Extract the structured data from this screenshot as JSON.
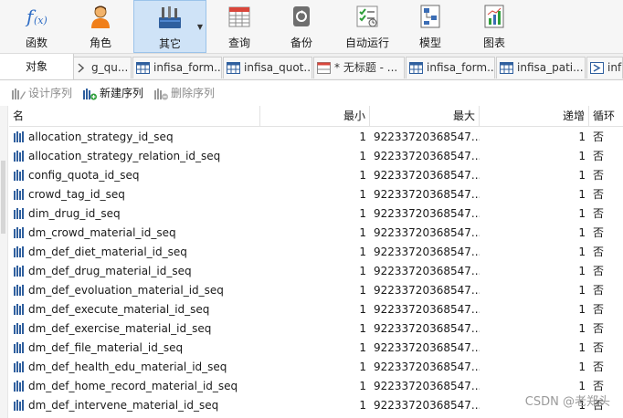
{
  "toolbar": {
    "buttons": [
      {
        "label": "函数",
        "icon": "function-icon"
      },
      {
        "label": "角色",
        "icon": "user-icon"
      },
      {
        "label": "其它",
        "icon": "tools-icon",
        "active": true
      },
      {
        "label": "查询",
        "icon": "query-table-icon"
      },
      {
        "label": "备份",
        "icon": "backup-icon"
      },
      {
        "label": "自动运行",
        "icon": "checklist-icon"
      },
      {
        "label": "模型",
        "icon": "model-icon"
      },
      {
        "label": "图表",
        "icon": "chart-icon"
      }
    ],
    "caret": "▼"
  },
  "tabs": {
    "objects_label": "对象",
    "items": [
      {
        "label": "g_qu..."
      },
      {
        "label": "infisa_form..."
      },
      {
        "label": "infisa_quot..."
      },
      {
        "label": "* 无标题 - ..."
      },
      {
        "label": "infisa_form..."
      },
      {
        "label": "infisa_pati..."
      },
      {
        "label": "inf"
      }
    ]
  },
  "actions": {
    "design": "设计序列",
    "create": "新建序列",
    "delete": "删除序列"
  },
  "grid": {
    "columns": [
      "名",
      "最小",
      "最大",
      "递增",
      "循环"
    ],
    "rows": [
      {
        "name": "allocation_strategy_id_seq",
        "min": "1",
        "max": "92233720368547...",
        "inc": "1",
        "cycle": "否"
      },
      {
        "name": "allocation_strategy_relation_id_seq",
        "min": "1",
        "max": "92233720368547...",
        "inc": "1",
        "cycle": "否"
      },
      {
        "name": "config_quota_id_seq",
        "min": "1",
        "max": "92233720368547...",
        "inc": "1",
        "cycle": "否"
      },
      {
        "name": "crowd_tag_id_seq",
        "min": "1",
        "max": "92233720368547...",
        "inc": "1",
        "cycle": "否"
      },
      {
        "name": "dim_drug_id_seq",
        "min": "1",
        "max": "92233720368547...",
        "inc": "1",
        "cycle": "否"
      },
      {
        "name": "dm_crowd_material_id_seq",
        "min": "1",
        "max": "92233720368547...",
        "inc": "1",
        "cycle": "否"
      },
      {
        "name": "dm_def_diet_material_id_seq",
        "min": "1",
        "max": "92233720368547...",
        "inc": "1",
        "cycle": "否"
      },
      {
        "name": "dm_def_drug_material_id_seq",
        "min": "1",
        "max": "92233720368547...",
        "inc": "1",
        "cycle": "否"
      },
      {
        "name": "dm_def_evoluation_material_id_seq",
        "min": "1",
        "max": "92233720368547...",
        "inc": "1",
        "cycle": "否"
      },
      {
        "name": "dm_def_execute_material_id_seq",
        "min": "1",
        "max": "92233720368547...",
        "inc": "1",
        "cycle": "否"
      },
      {
        "name": "dm_def_exercise_material_id_seq",
        "min": "1",
        "max": "92233720368547...",
        "inc": "1",
        "cycle": "否"
      },
      {
        "name": "dm_def_file_material_id_seq",
        "min": "1",
        "max": "92233720368547...",
        "inc": "1",
        "cycle": "否"
      },
      {
        "name": "dm_def_health_edu_material_id_seq",
        "min": "1",
        "max": "92233720368547...",
        "inc": "1",
        "cycle": "否"
      },
      {
        "name": "dm_def_home_record_material_id_seq",
        "min": "1",
        "max": "92233720368547...",
        "inc": "1",
        "cycle": "否"
      },
      {
        "name": "dm_def_intervene_material_id_seq",
        "min": "1",
        "max": "92233720368547...",
        "inc": "1",
        "cycle": "否"
      }
    ]
  },
  "watermark": "CSDN @老郑头",
  "colors": {
    "accent": "#1e6fd1",
    "active_bg": "#cfe3f7"
  }
}
